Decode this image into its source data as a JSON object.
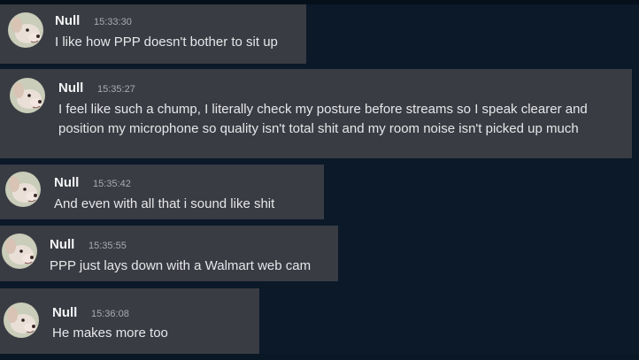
{
  "colors": {
    "background": "#0b1929",
    "bubble": "#3a3c43",
    "username": "#f2f3f5",
    "timestamp": "#a9abb0",
    "text": "#e6e7e9"
  },
  "messages": [
    {
      "author": "Null",
      "time": "15:33:30",
      "text": "I like how PPP doesn't bother to sit up"
    },
    {
      "author": "Null",
      "time": "15:35:27",
      "text": "I feel like such a chump, I literally check my posture before streams so I speak clearer and position my microphone so quality isn't total shit and my room noise isn't picked up much"
    },
    {
      "author": "Null",
      "time": "15:35:42",
      "text": "And even with all that i sound like shit"
    },
    {
      "author": "Null",
      "time": "15:35:55",
      "text": "PPP just lays down with a Walmart web cam"
    },
    {
      "author": "Null",
      "time": "15:36:08",
      "text": "He makes more too"
    }
  ]
}
